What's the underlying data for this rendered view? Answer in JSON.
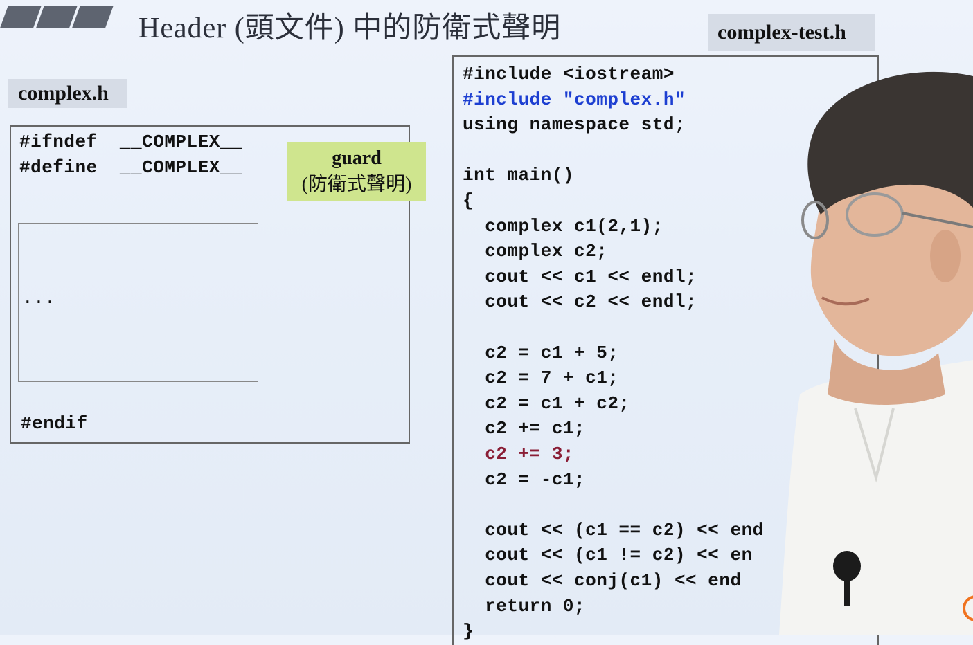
{
  "slide": {
    "title": "Header (頭文件) 中的防衛式聲明"
  },
  "left_panel": {
    "tab_label": "complex.h",
    "line1": "#ifndef  __COMPLEX__",
    "line2": "#define  __COMPLEX__",
    "ellipsis": "...",
    "endif": "#endif"
  },
  "guard_note": {
    "line1": "guard",
    "line2": "(防衛式聲明)"
  },
  "right_panel": {
    "tab_label": "complex-test.h",
    "code": [
      {
        "text": "#include <iostream>",
        "style": "normal"
      },
      {
        "text": "#include \"complex.h\"",
        "style": "blue"
      },
      {
        "text": "using namespace std;",
        "style": "normal"
      },
      {
        "text": "",
        "style": "normal"
      },
      {
        "text": "int main()",
        "style": "normal"
      },
      {
        "text": "{",
        "style": "normal"
      },
      {
        "text": "  complex c1(2,1);",
        "style": "normal"
      },
      {
        "text": "  complex c2;",
        "style": "normal"
      },
      {
        "text": "  cout << c1 << endl;",
        "style": "normal"
      },
      {
        "text": "  cout << c2 << endl;",
        "style": "normal"
      },
      {
        "text": "",
        "style": "normal"
      },
      {
        "text": "  c2 = c1 + 5;",
        "style": "normal"
      },
      {
        "text": "  c2 = 7 + c1;",
        "style": "normal"
      },
      {
        "text": "  c2 = c1 + c2;",
        "style": "normal"
      },
      {
        "text": "  c2 += c1;",
        "style": "normal"
      },
      {
        "text": "  c2 += 3;",
        "style": "red"
      },
      {
        "text": "  c2 = -c1;",
        "style": "normal"
      },
      {
        "text": "",
        "style": "normal"
      },
      {
        "text": "  cout << (c1 == c2) << end",
        "style": "normal"
      },
      {
        "text": "  cout << (c1 != c2) << en",
        "style": "normal"
      },
      {
        "text": "  cout << conj(c1) << end",
        "style": "normal"
      },
      {
        "text": "  return 0;",
        "style": "normal"
      },
      {
        "text": "}",
        "style": "normal"
      }
    ]
  },
  "colors": {
    "background": "#e8eff9",
    "tab_bg": "#d6dce6",
    "guard_bg": "#cfe58e",
    "blue_code": "#1d3fd1",
    "red_code": "#8a1e36"
  }
}
